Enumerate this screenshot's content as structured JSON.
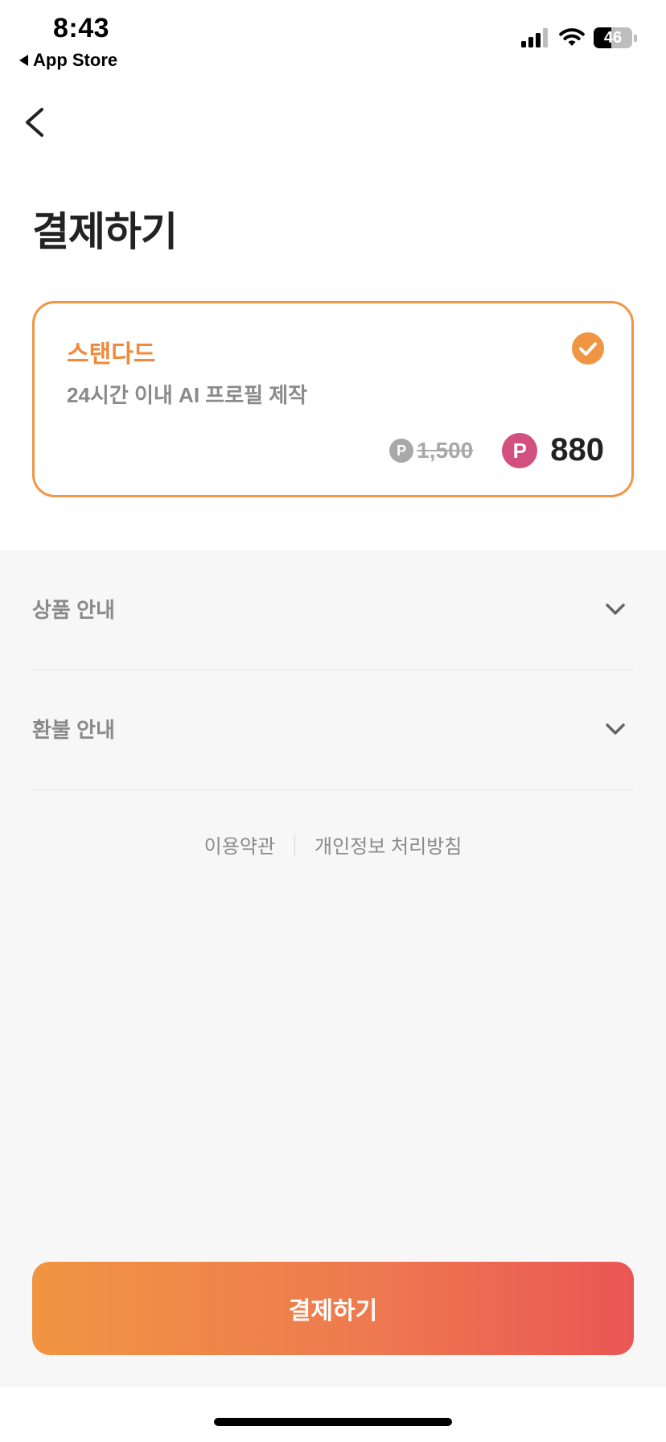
{
  "status_bar": {
    "time": "8:43",
    "back_app": "App Store",
    "battery_percent": 46
  },
  "header": {
    "title": "결제하기"
  },
  "product": {
    "name": "스탠다드",
    "description": "24시간 이내 AI 프로필 제작",
    "point_symbol": "P",
    "original_price": "1,500",
    "discount_price": "880",
    "selected": true
  },
  "info_sections": [
    {
      "label": "상품 안내"
    },
    {
      "label": "환불 안내"
    }
  ],
  "footer_links": {
    "terms": "이용약관",
    "privacy": "개인정보 처리방침"
  },
  "cta": {
    "label": "결제하기"
  },
  "colors": {
    "accent": "#ef9543",
    "point_badge": "#d24f7e",
    "button_gradient_start": "#f09542",
    "button_gradient_end": "#ea5654"
  }
}
